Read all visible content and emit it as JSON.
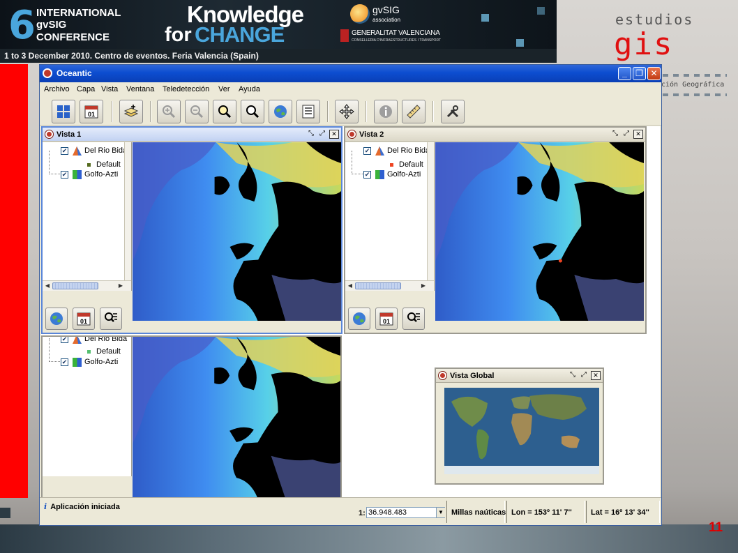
{
  "banner": {
    "conference_number": "6",
    "conference_line1": "INTERNATIONAL",
    "conference_line2": "gvSIG",
    "conference_line3": "CONFERENCE",
    "knowledge": "Knowledge",
    "for_word": "for",
    "change_word": "CHANGE",
    "gvsig_association": "gvSIG",
    "gvsig_association_sub": "association",
    "generalitat": "GENERALITAT VALENCIANA",
    "generalitat_sub": "CONSELLERIA D'INFRAESTRUCTURES I TRANSPORT",
    "dates": "1 to 3 December 2010. Centro de eventos. Feria Valencia (Spain)"
  },
  "logo": {
    "estudios": "estudios",
    "gis": "gis",
    "tagline": "ción Geográfica"
  },
  "slide_number": "11",
  "app": {
    "title": "Oceantic",
    "menu": [
      "Archivo",
      "Capa",
      "Vista",
      "Ventana",
      "Teledetección",
      "Ver",
      "Ayuda"
    ],
    "toolbar_icons": [
      "tile-windows-icon",
      "calendar-icon",
      "add-layer-icon",
      "zoom-in-icon",
      "zoom-out-icon",
      "zoom-full-icon",
      "zoom-select-icon",
      "globe-icon",
      "layer-list-icon",
      "pan-icon",
      "info-icon",
      "measure-icon",
      "tools-icon"
    ],
    "calendar_day": "01",
    "colors": {
      "titlebar": "#0c4dd0",
      "active_frame": "#5a86d8",
      "toc_checkbox": "#1c5180"
    }
  },
  "vista1": {
    "title": "Vista 1",
    "layers": [
      {
        "name": "Del Rio Bida",
        "checked": true
      },
      {
        "name": "Default",
        "legend_color": "#556b1f"
      },
      {
        "name": "Golfo-Azti",
        "checked": true
      }
    ]
  },
  "vista2": {
    "title": "Vista 2",
    "layers": [
      {
        "name": "Del Rio Bida",
        "checked": true
      },
      {
        "name": "Default",
        "legend_color": "#ee4422"
      },
      {
        "name": "Golfo-Azti",
        "checked": true
      }
    ]
  },
  "vista3": {
    "layers": [
      {
        "name": "Del Rio Bida",
        "checked": true
      },
      {
        "name": "Default",
        "legend_color": "#55c070"
      },
      {
        "name": "Golfo-Azti",
        "checked": true
      }
    ]
  },
  "vista_global": {
    "title": "Vista Global"
  },
  "status": {
    "message": "Aplicación iniciada",
    "scale_prefix": "1:",
    "scale_value": "36.948.483",
    "units": "Millas naúticas",
    "lon": "Lon = 153º 11' 7''",
    "lat": "Lat = 16º 13' 34''"
  }
}
